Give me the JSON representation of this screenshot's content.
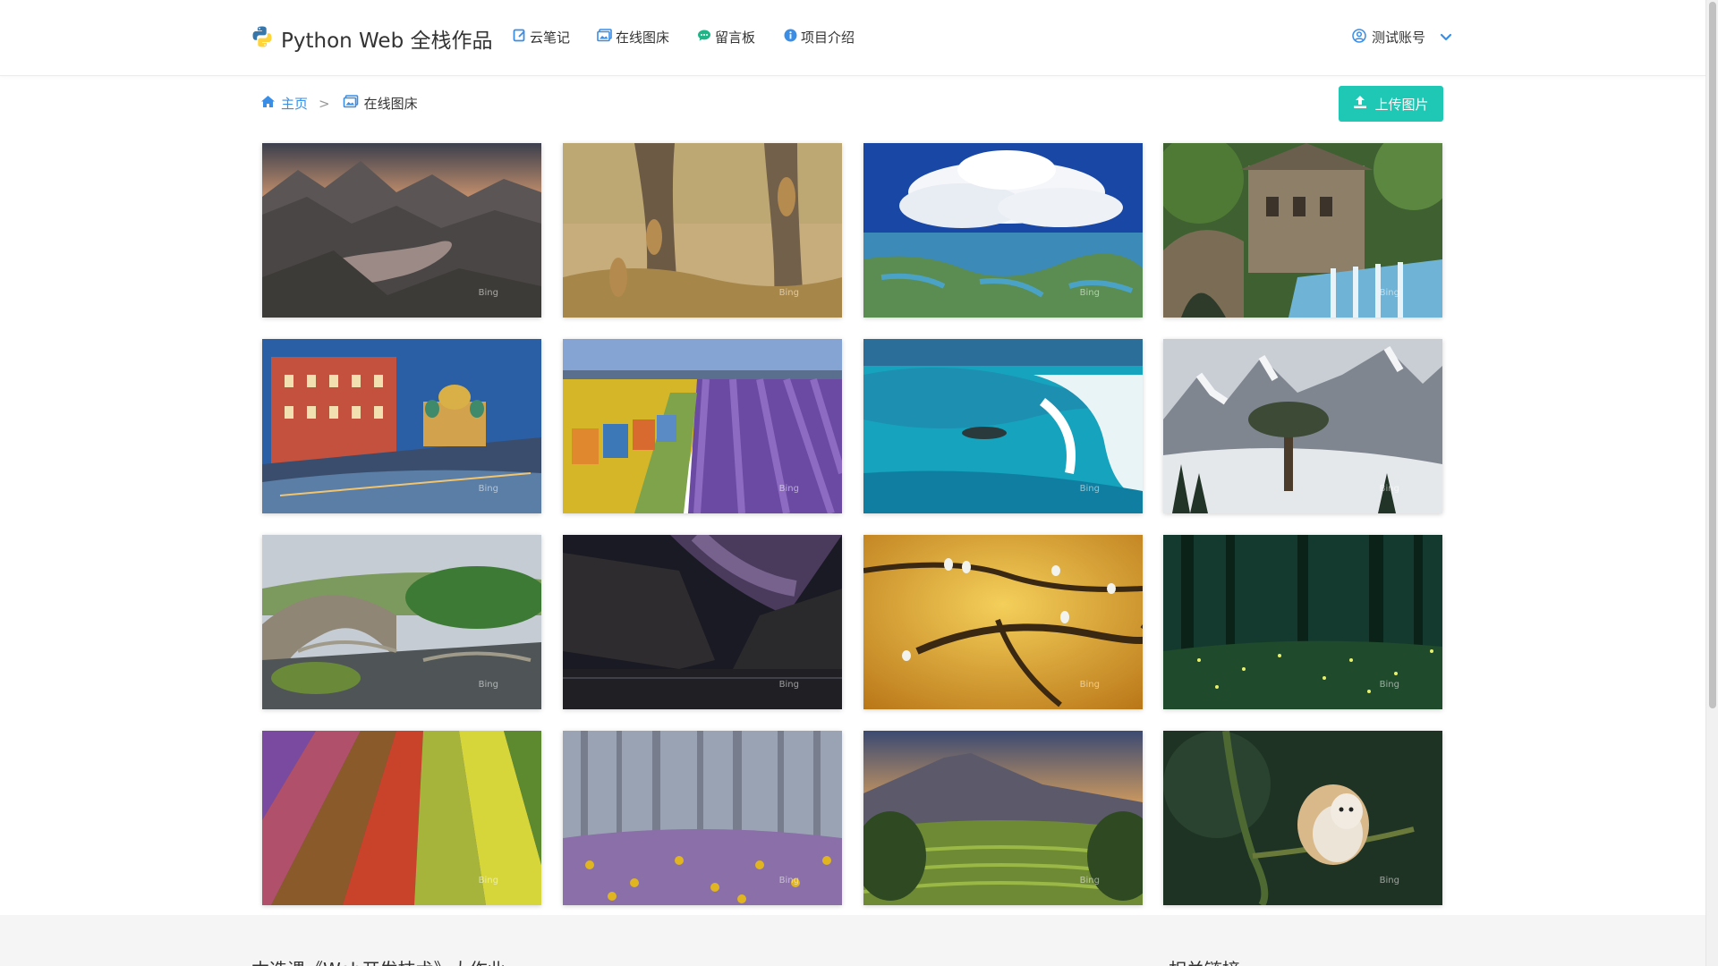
{
  "nav": {
    "brand": "Python Web 全栈作品",
    "items": [
      {
        "label": "云笔记",
        "icon": "note-icon"
      },
      {
        "label": "在线图床",
        "icon": "image-icon"
      },
      {
        "label": "留言板",
        "icon": "chat-icon"
      },
      {
        "label": "项目介绍",
        "icon": "info-icon"
      }
    ],
    "user": {
      "label": "测试账号",
      "icon": "user-circle-icon",
      "caret": "chevron-down-icon"
    }
  },
  "breadcrumb": {
    "home": "主页",
    "separator": ">",
    "current": "在线图床"
  },
  "upload_button": "上传图片",
  "gallery": {
    "watermark": "Bing",
    "images": [
      {
        "name": "mountain-lake-sunset"
      },
      {
        "name": "cheetah-cubs-tree"
      },
      {
        "name": "clouds-over-wetland"
      },
      {
        "name": "stone-mill-waterfall"
      },
      {
        "name": "canal-church-city"
      },
      {
        "name": "sunflower-lavender-field"
      },
      {
        "name": "sea-lion-wave"
      },
      {
        "name": "snowy-mountain-tree"
      },
      {
        "name": "stone-arch-bridge"
      },
      {
        "name": "milky-way-canyon"
      },
      {
        "name": "birds-on-branches"
      },
      {
        "name": "firefly-forest"
      },
      {
        "name": "tulip-field-aerial"
      },
      {
        "name": "misty-forest-flowers"
      },
      {
        "name": "volcano-rice-terraces"
      },
      {
        "name": "barn-owl-branch"
      }
    ]
  },
  "footer": {
    "left_heading": "本选课《Web开发技术》大作业",
    "right_heading": "相关链接"
  },
  "colors": {
    "link": "#3a8ee6",
    "upload": "#1fc8b4",
    "python_blue": "#3776ab",
    "python_yellow": "#ffd43b"
  }
}
